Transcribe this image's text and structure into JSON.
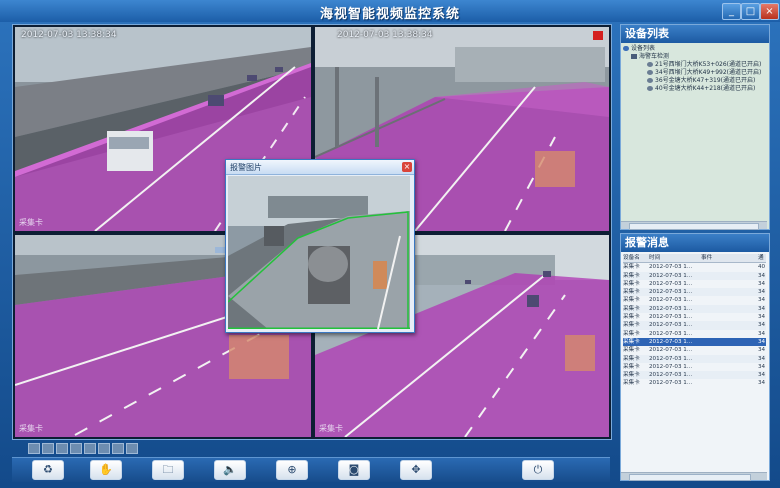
{
  "window": {
    "title": "海视智能视频监控系统",
    "controls": {
      "min": "_",
      "max": "□",
      "close": "×"
    }
  },
  "video": {
    "cells": [
      {
        "timestamp": "2012-07-03  13:38:34",
        "label": "采集卡"
      },
      {
        "timestamp": "2012-07-03  13:38:34",
        "label": ""
      },
      {
        "timestamp": "",
        "label": "采集卡"
      },
      {
        "timestamp": "",
        "label": "采集卡"
      }
    ],
    "popup": {
      "title": "报警图片",
      "close": "×"
    }
  },
  "toolbar": {
    "buttons": [
      {
        "icon": "recycle-icon",
        "glyph": "♻"
      },
      {
        "icon": "hand-icon",
        "glyph": "✋"
      },
      {
        "icon": "folder-icon",
        "glyph": "🗀"
      },
      {
        "icon": "speaker-icon",
        "glyph": "🔈"
      },
      {
        "icon": "zoom-icon",
        "glyph": "⊕"
      },
      {
        "icon": "camera-icon",
        "glyph": "◙"
      },
      {
        "icon": "ptz-move-icon",
        "glyph": "✥"
      },
      {
        "icon": "power-icon",
        "glyph": "⏻"
      }
    ]
  },
  "device_panel": {
    "title": "设备列表",
    "root": "设备列表",
    "group": "海警车检测",
    "items": [
      "21号西堠门大桥K53+026(通道已开启)",
      "34号西堠门大桥K49+992(通道已开启)",
      "36号金塘大桥K47+319(通道已开启)",
      "40号金塘大桥K44+218(通道已开启)"
    ]
  },
  "alarm_panel": {
    "title": "报警消息",
    "columns": [
      "设备名",
      "时间",
      "事件",
      "通"
    ],
    "rows": [
      {
        "device": "采集卡",
        "time": "2012-07-03 1...",
        "event": "",
        "ch": "40"
      },
      {
        "device": "采集卡",
        "time": "2012-07-03 1...",
        "event": "",
        "ch": "34"
      },
      {
        "device": "采集卡",
        "time": "2012-07-03 1...",
        "event": "",
        "ch": "34"
      },
      {
        "device": "采集卡",
        "time": "2012-07-03 1...",
        "event": "",
        "ch": "34"
      },
      {
        "device": "采集卡",
        "time": "2012-07-03 1...",
        "event": "",
        "ch": "34"
      },
      {
        "device": "采集卡",
        "time": "2012-07-03 1...",
        "event": "",
        "ch": "34"
      },
      {
        "device": "采集卡",
        "time": "2012-07-03 1...",
        "event": "",
        "ch": "34"
      },
      {
        "device": "采集卡",
        "time": "2012-07-03 1...",
        "event": "",
        "ch": "34"
      },
      {
        "device": "采集卡",
        "time": "2012-07-03 1...",
        "event": "",
        "ch": "34"
      },
      {
        "device": "采集卡",
        "time": "2012-07-03 1...",
        "event": "",
        "ch": "34"
      },
      {
        "device": "采集卡",
        "time": "2012-07-03 1...",
        "event": "",
        "ch": "34"
      },
      {
        "device": "采集卡",
        "time": "2012-07-03 1...",
        "event": "",
        "ch": "34"
      },
      {
        "device": "采集卡",
        "time": "2012-07-03 1...",
        "event": "",
        "ch": "34"
      },
      {
        "device": "采集卡",
        "time": "2012-07-03 1...",
        "event": "",
        "ch": "34"
      },
      {
        "device": "采集卡",
        "time": "2012-07-03 1...",
        "event": "",
        "ch": "34"
      }
    ],
    "selected_row": 9
  },
  "colors": {
    "accent": "#1c5ea8",
    "alarm_border": "#e02626",
    "overlay": "#b13bb5",
    "selected": "#2e64b5"
  }
}
